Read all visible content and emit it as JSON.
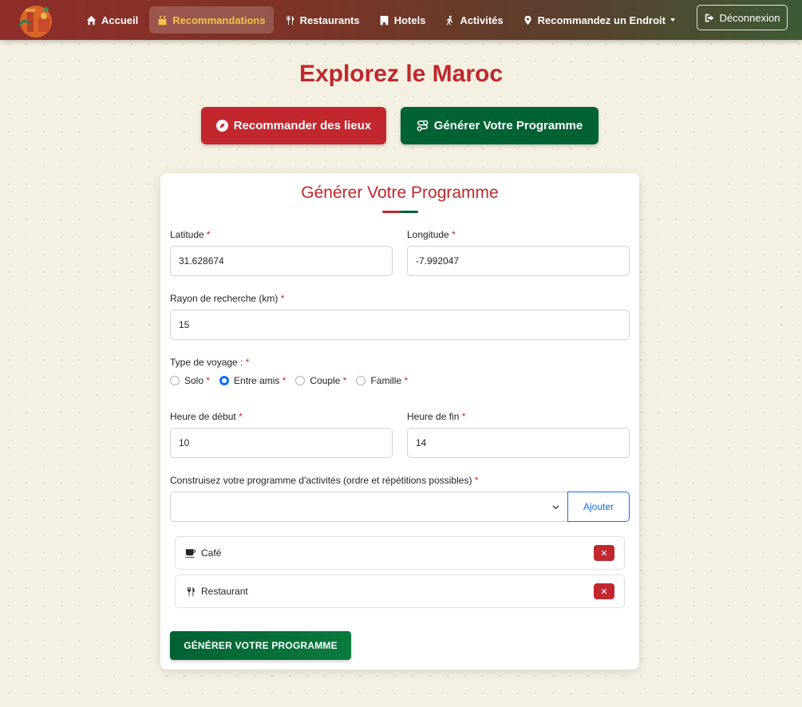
{
  "nav": {
    "items": [
      {
        "label": "Accueil",
        "icon": "home-icon"
      },
      {
        "label": "Recommandations",
        "icon": "calendar-icon",
        "active": true
      },
      {
        "label": "Restaurants",
        "icon": "utensils-icon"
      },
      {
        "label": "Hotels",
        "icon": "building-icon"
      },
      {
        "label": "Activités",
        "icon": "walking-icon"
      },
      {
        "label": "Recommandez un Endroit",
        "icon": "map-pin-icon",
        "dropdown": true
      }
    ],
    "logout_label": "Déconnexion"
  },
  "header": {
    "title": "Explorez le Maroc",
    "recommend_label": "Recommander des lieux",
    "generate_label": "Générer Votre Programme"
  },
  "form": {
    "title": "Générer Votre Programme",
    "latitude_label": "Latitude",
    "latitude_value": "31.628674",
    "longitude_label": "Longitude",
    "longitude_value": "-7.992047",
    "radius_label": "Rayon de recherche (km)",
    "radius_value": "15",
    "travel_type_label": "Type de voyage :",
    "travel_types": [
      {
        "label": "Solo",
        "checked": false
      },
      {
        "label": "Entre amis",
        "checked": true
      },
      {
        "label": "Couple",
        "checked": false
      },
      {
        "label": "Famille",
        "checked": false
      }
    ],
    "start_label": "Heure de début",
    "start_value": "10",
    "end_label": "Heure de fin",
    "end_value": "14",
    "program_label": "Construisez votre programme d'activités (ordre et répétitions possibles)",
    "select_value": "",
    "add_label": "Ajouter",
    "activities": [
      {
        "label": "Café",
        "icon": "coffee-icon"
      },
      {
        "label": "Restaurant",
        "icon": "utensils-icon"
      }
    ],
    "remove_label": "✕",
    "submit_label": "GÉNÉRER VOTRE PROGRAMME",
    "required_mark": "*"
  },
  "colors": {
    "red": "#c1272d",
    "green": "#006233",
    "active_nav": "#f5c542",
    "background": "#f5f1e2"
  }
}
